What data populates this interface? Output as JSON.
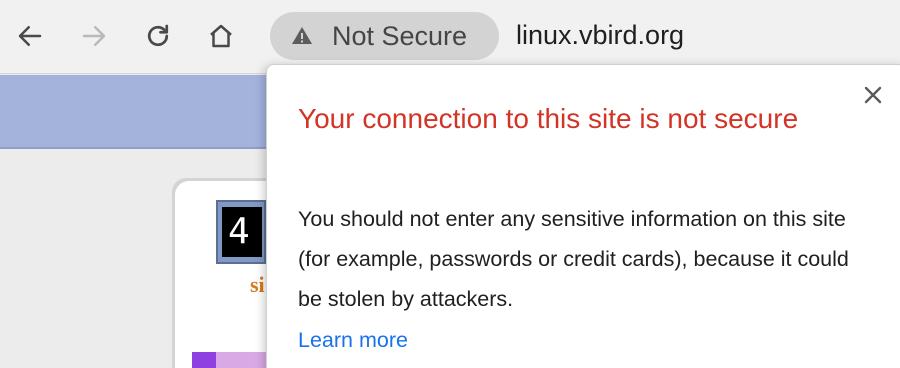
{
  "toolbar": {
    "back_icon": "arrow-left-icon",
    "forward_icon": "arrow-right-icon",
    "reload_icon": "reload-icon",
    "home_icon": "home-icon"
  },
  "omnibox": {
    "security_label": "Not Secure",
    "security_icon": "warning-triangle-icon",
    "url": "linux.vbird.org"
  },
  "page": {
    "logo_text": "4",
    "orange_text": "si",
    "band_color": "#a3b3dc"
  },
  "popup": {
    "title": "Your connection to this site is not secure",
    "body": "You should not enter any sensitive information on this site (for example, passwords or credit cards), because it could be stolen by attackers.",
    "learn_more": "Learn more",
    "close_icon": "close-icon",
    "title_color": "#d23426",
    "link_color": "#1a73e8"
  }
}
